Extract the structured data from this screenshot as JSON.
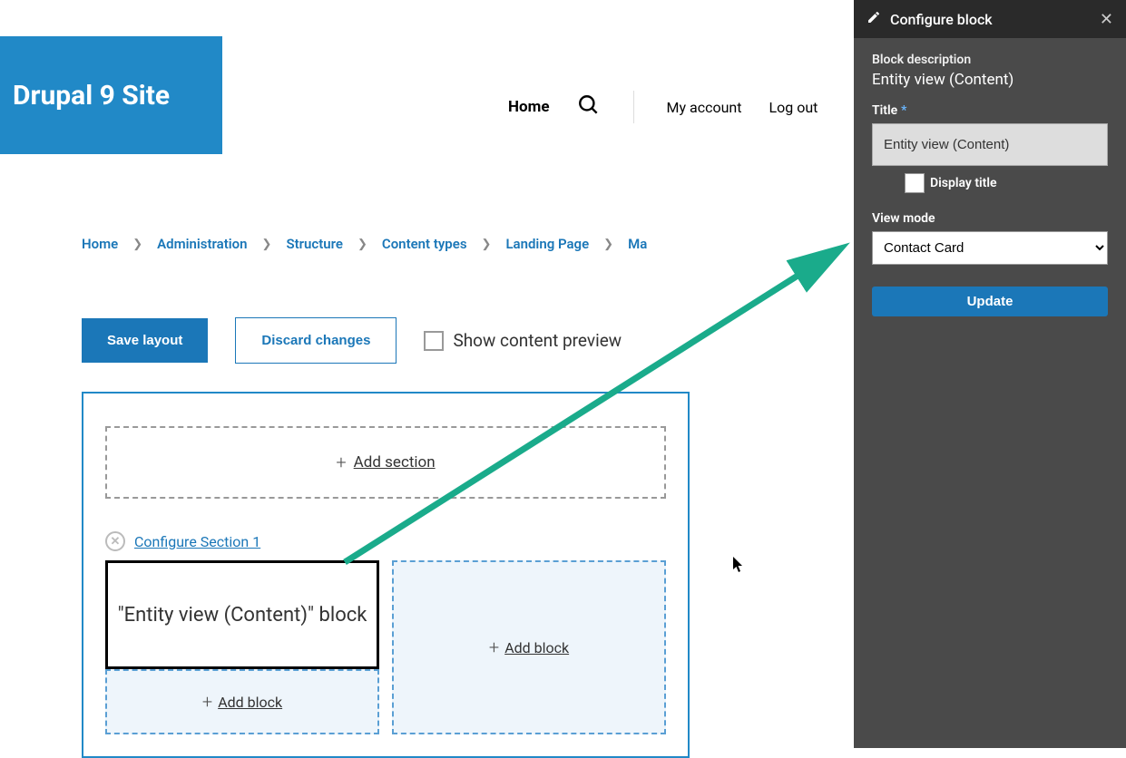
{
  "site": {
    "name": "Drupal 9 Site"
  },
  "nav": {
    "home": "Home",
    "my_account": "My account",
    "log_out": "Log out"
  },
  "breadcrumb": {
    "items": [
      "Home",
      "Administration",
      "Structure",
      "Content types",
      "Landing Page",
      "Ma"
    ]
  },
  "actions": {
    "save": "Save layout",
    "discard": "Discard changes",
    "preview_label": "Show content preview"
  },
  "layout": {
    "add_section": "Add section",
    "configure_section": "Configure Section 1",
    "block_label": "\"Entity view (Content)\" block",
    "add_block": "Add block"
  },
  "panel": {
    "title": "Configure block",
    "block_desc_label": "Block description",
    "block_desc": "Entity view (Content)",
    "title_label": "Title",
    "title_value": "Entity view (Content)",
    "display_title": "Display title",
    "view_mode_label": "View mode",
    "view_mode_value": "Contact Card",
    "update": "Update"
  }
}
